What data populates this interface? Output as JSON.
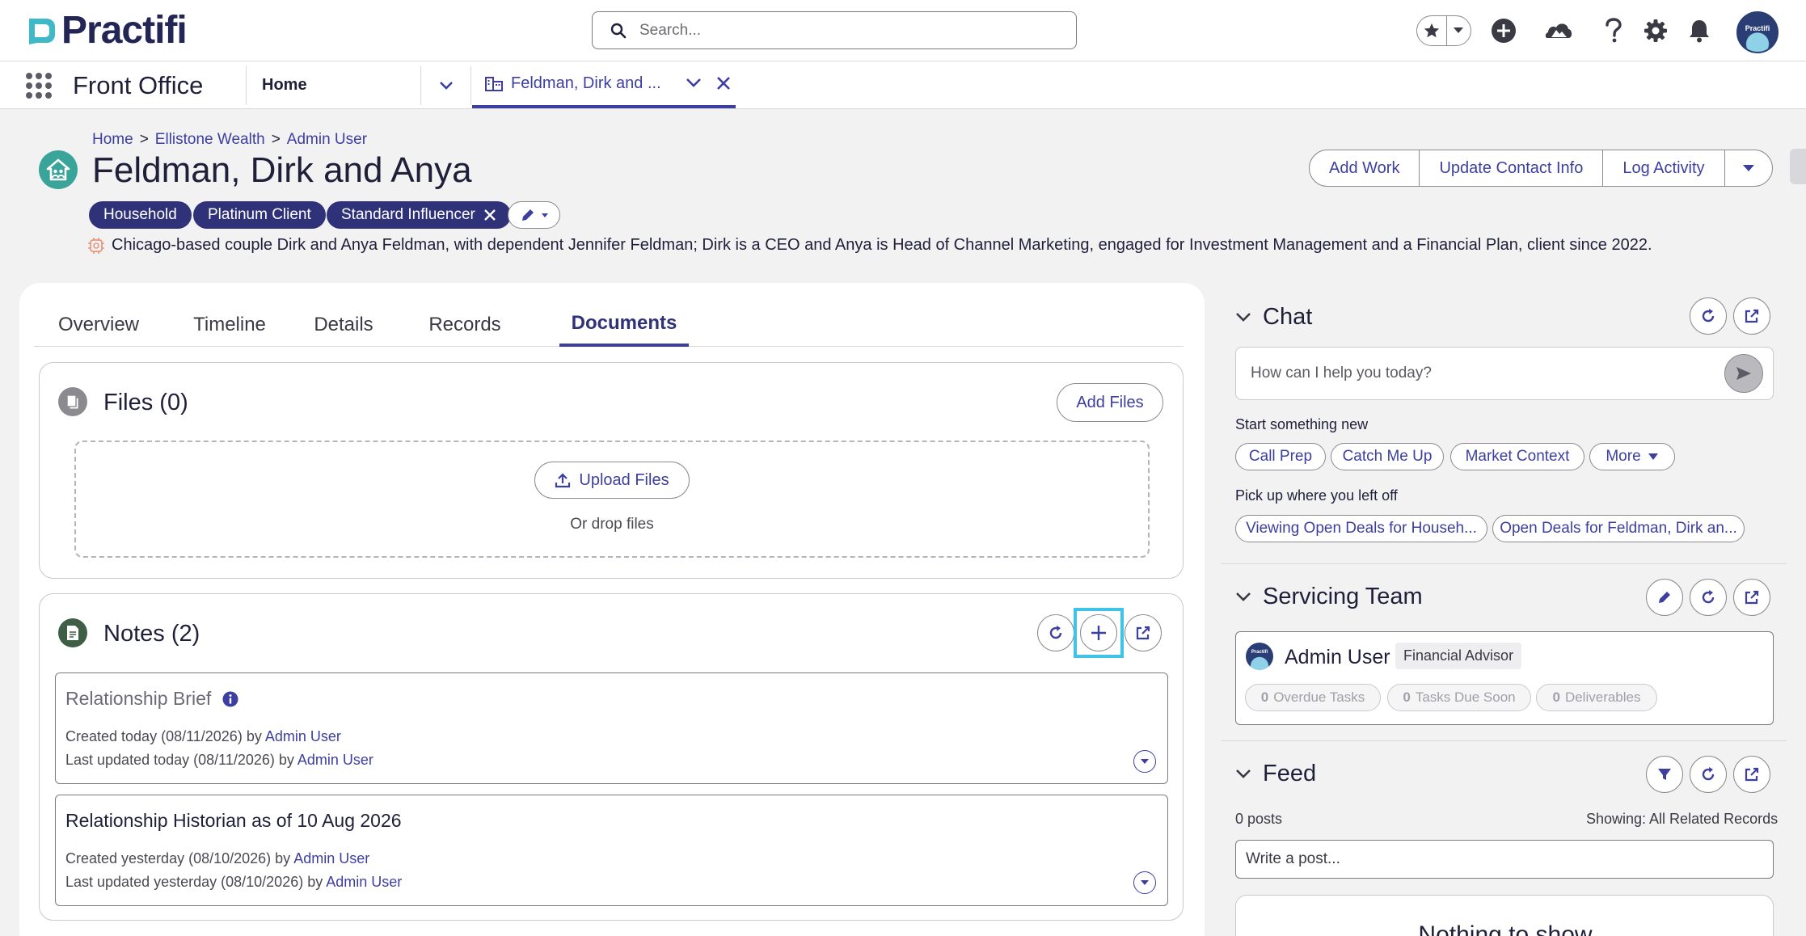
{
  "app": {
    "logo_text": "Practifi",
    "search_placeholder": "Search...",
    "avatar_text": "Practifi"
  },
  "nav": {
    "app_name": "Front Office",
    "home_tab": "Home",
    "record_tab": "Feldman, Dirk and ..."
  },
  "record": {
    "breadcrumb": [
      "Home",
      "Ellistone Wealth",
      "Admin User"
    ],
    "breadcrumb_sep": ">",
    "title": "Feldman, Dirk and Anya",
    "tags": [
      "Household",
      "Platinum Client",
      "Standard Influencer"
    ],
    "summary": "Chicago-based couple Dirk and Anya Feldman, with dependent Jennifer Feldman; Dirk is a CEO and Anya is Head of Channel Marketing, engaged for Investment Management and a Financial Plan, client since 2022.",
    "actions": [
      "Add Work",
      "Update Contact Info",
      "Log Activity"
    ]
  },
  "tabs": [
    {
      "label": "Overview",
      "active": false
    },
    {
      "label": "Timeline",
      "active": false
    },
    {
      "label": "Details",
      "active": false
    },
    {
      "label": "Records",
      "active": false
    },
    {
      "label": "Documents",
      "active": true
    }
  ],
  "files": {
    "title": "Files (0)",
    "add_button": "Add Files",
    "upload_button": "Upload Files",
    "drop_text": "Or drop files"
  },
  "notes": {
    "title": "Notes (2)",
    "items": [
      {
        "title": "Relationship Brief",
        "created": "Created today (08/11/2026) by ",
        "created_by": "Admin User",
        "updated": "Last updated today (08/11/2026) by ",
        "updated_by": "Admin User"
      },
      {
        "title": "Relationship Historian as of 10 Aug 2026",
        "created": "Created yesterday (08/10/2026) by ",
        "created_by": "Admin User",
        "updated": "Last updated yesterday (08/10/2026) by ",
        "updated_by": "Admin User"
      }
    ]
  },
  "chat": {
    "title": "Chat",
    "placeholder": "How can I help you today?",
    "start_label": "Start something new",
    "suggestions": [
      "Call Prep",
      "Catch Me Up",
      "Market Context",
      "More"
    ],
    "resume_label": "Pick up where you left off",
    "recent": [
      "Viewing Open Deals for Househ...",
      "Open Deals for Feldman, Dirk an..."
    ]
  },
  "team": {
    "title": "Servicing Team",
    "member_name": "Admin User",
    "member_role": "Financial Advisor",
    "avatar_text": "Practifi",
    "stats": [
      {
        "count": "0",
        "label": "Overdue Tasks"
      },
      {
        "count": "0",
        "label": "Tasks Due Soon"
      },
      {
        "count": "0",
        "label": "Deliverables"
      }
    ]
  },
  "feed": {
    "title": "Feed",
    "posts_count": "0 posts",
    "showing": "Showing: All Related Records",
    "post_placeholder": "Write a post...",
    "empty_text": "Nothing to show"
  },
  "colors": {
    "brand": "#2f3279",
    "link": "#3d3fa0",
    "household_icon": "#3aa39a",
    "highlight": "#3fc4e8"
  }
}
